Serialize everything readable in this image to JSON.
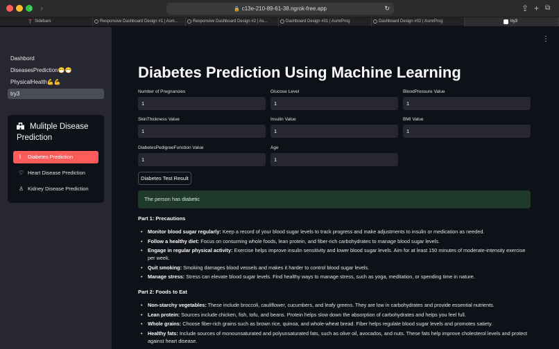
{
  "browser": {
    "url": "c13e-210-89-61-38.ngrok-free.app",
    "tabs": [
      {
        "label": "Sidebars"
      },
      {
        "label": "Responsive Dashboard Design #1 | Asm..."
      },
      {
        "label": "Responsive Dashboard Design #2 | As..."
      },
      {
        "label": "Dashboard Design #01 | AsmrProg"
      },
      {
        "label": "Dashboard Design #02 | AsmrProg"
      },
      {
        "label": "try3"
      }
    ],
    "active_tab": 5
  },
  "sidebar": {
    "pages": [
      {
        "label": "Dashbord"
      },
      {
        "label": "DiseasesPrediction😷😷"
      },
      {
        "label": "PhysicalHealth💪💪"
      },
      {
        "label": "try3"
      }
    ],
    "active_page": 3,
    "menu": {
      "title": "Mulitple Disease Prediction",
      "options": [
        {
          "label": "Diabetes Prediction",
          "icon": "activity-icon"
        },
        {
          "label": "Heart Disease Prediction",
          "icon": "heart-icon"
        },
        {
          "label": "Kidney Disease Prediction",
          "icon": "person-icon"
        }
      ],
      "selected": 0,
      "accent": "#ff5b5b"
    }
  },
  "main": {
    "title": "Diabetes Prediction Using Machine Learning",
    "fields": [
      {
        "label": "Number of Pregnancies",
        "value": "1"
      },
      {
        "label": "Glucose Level",
        "value": "1"
      },
      {
        "label": "BloodPressure Value",
        "value": "1"
      },
      {
        "label": "SkinThickness Value",
        "value": "1"
      },
      {
        "label": "Insulin Value",
        "value": "1"
      },
      {
        "label": "BMI Value",
        "value": "1"
      },
      {
        "label": "DiabetesPedigreeFunction Value",
        "value": "1"
      },
      {
        "label": "Age",
        "value": "1"
      }
    ],
    "button_label": "Diabetes Test Result",
    "result": "The person has diabetic",
    "part1": {
      "title": "Part 1: Precautions",
      "items": [
        {
          "bold": "Monitor blood sugar regularly:",
          "text": " Keep a record of your blood sugar levels to track progress and make adjustments to insulin or medication as needed."
        },
        {
          "bold": "Follow a healthy diet:",
          "text": " Focus on consuming whole foods, lean protein, and fiber-rich carbohydrates to manage blood sugar levels."
        },
        {
          "bold": "Engage in regular physical activity:",
          "text": " Exercise helps improve insulin sensitivity and lower blood sugar levels. Aim for at least 150 minutes of moderate-intensity exercise per week."
        },
        {
          "bold": "Quit smoking:",
          "text": " Smoking damages blood vessels and makes it harder to control blood sugar levels."
        },
        {
          "bold": "Manage stress:",
          "text": " Stress can elevate blood sugar levels. Find healthy ways to manage stress, such as yoga, meditation, or spending time in nature."
        }
      ]
    },
    "part2": {
      "title": "Part 2: Foods to Eat",
      "items": [
        {
          "bold": "Non-starchy vegetables:",
          "text": " These include broccoli, cauliflower, cucumbers, and leafy greens. They are low in carbohydrates and provide essential nutrients."
        },
        {
          "bold": "Lean protein:",
          "text": " Sources include chicken, fish, tofu, and beans. Protein helps slow down the absorption of carbohydrates and helps you feel full."
        },
        {
          "bold": "Whole grains:",
          "text": " Choose fiber-rich grains such as brown rice, quinoa, and whole-wheat bread. Fiber helps regulate blood sugar levels and promotes satiety."
        },
        {
          "bold": "Healthy fats:",
          "text": " Include sources of monounsaturated and polyunsaturated fats, such as olive oil, avocados, and nuts. These fats help improve cholesterol levels and protect against heart disease."
        }
      ]
    }
  }
}
